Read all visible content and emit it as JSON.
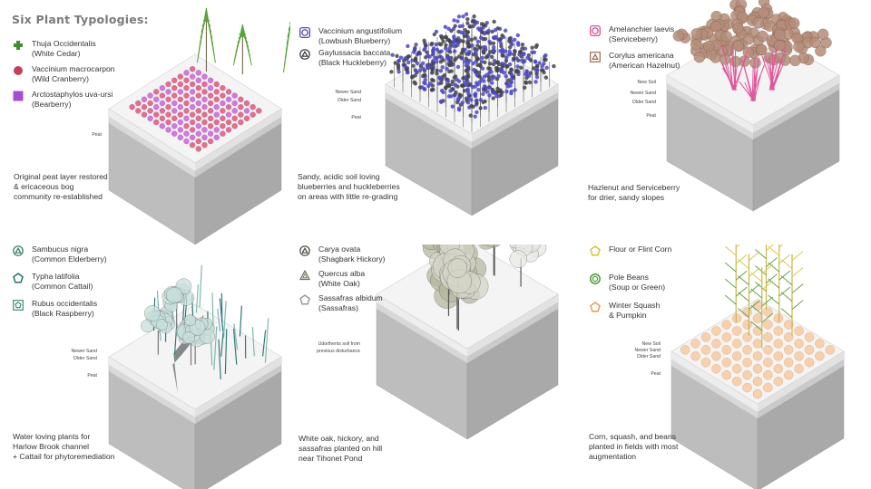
{
  "title": "Six Plant Typologies:",
  "panels": [
    {
      "legend": [
        {
          "name": "Thuja Occidentalis",
          "common": "(White Cedar)",
          "icon": "cross-icon",
          "color": "#3f8f2f"
        },
        {
          "name": "Vaccinium macrocarpon",
          "common": "(Wild Cranberry)",
          "icon": "circle-icon",
          "color": "#c6405e"
        },
        {
          "name": "Arctostaphylos uva-ursi",
          "common": "(Bearberry)",
          "icon": "square-icon",
          "color": "#a94ccf"
        }
      ],
      "layers": [
        "Peat"
      ],
      "caption": [
        "Original peat layer restored",
        "& ericaceous bog",
        "community re-established"
      ]
    },
    {
      "legend": [
        {
          "name": "Vaccinium angustifolium",
          "common": "(Lowbush Blueberry)",
          "icon": "circle-in-square-icon",
          "color": "#3c3ab0"
        },
        {
          "name": "Gaylussacia baccata",
          "common": "(Black Huckleberry)",
          "icon": "triangle-in-circle-icon",
          "color": "#333333"
        }
      ],
      "layers": [
        "Newer Sand",
        "Older Sand",
        "Peat"
      ],
      "caption": [
        "Sandy, acidic soil loving",
        "blueberries and huckleberries",
        "on areas with little re-grading"
      ]
    },
    {
      "legend": [
        {
          "name": "Amelanchier laevis",
          "common": "(Serviceberry)",
          "icon": "circle-in-square-icon",
          "color": "#d63c8e"
        },
        {
          "name": "Corylus americana",
          "common": "(American Hazelnut)",
          "icon": "triangle-in-square-icon",
          "color": "#9a6a52"
        }
      ],
      "layers": [
        "New Soil",
        "Newer Sand",
        "Older Sand",
        "Peat"
      ],
      "caption": [
        "Hazlenut and Serviceberry",
        "for drier, sandy slopes"
      ]
    },
    {
      "legend": [
        {
          "name": "Sambucus nigra",
          "common": "(Common Elderberry)",
          "icon": "triangle-in-circle-icon",
          "color": "#2e7a5c"
        },
        {
          "name": "Typha latifolia",
          "common": "(Common Cattail)",
          "icon": "pentagon-icon",
          "color": "#1f6f6a"
        },
        {
          "name": "Rubus occidentalis",
          "common": "(Black Raspberry)",
          "icon": "pentagon-in-square-icon",
          "color": "#3d8f7a"
        }
      ],
      "layers": [
        "Newer Sand",
        "Older Sand",
        "Peat"
      ],
      "caption": [
        "Water loving plants for",
        "Harlow Brook channel",
        "+ Cattail for phytoremediation"
      ]
    },
    {
      "legend": [
        {
          "name": "Carya ovata",
          "common": "(Shagbark Hickory)",
          "icon": "triangle-in-circle-icon",
          "color": "#4a4a40"
        },
        {
          "name": "Quercus alba",
          "common": "(White Oak)",
          "icon": "triangle-icon",
          "color": "#6a6a5a"
        },
        {
          "name": "Sassafras albidum",
          "common": "(Sassafras)",
          "icon": "pentagon-icon",
          "color": "#9a9a90"
        }
      ],
      "layers": [
        "Udorthents soil from",
        "previous disturbance"
      ],
      "caption": [
        "White oak, hickory, and",
        "sassafras planted on hill",
        "near Tihonet Pond"
      ]
    },
    {
      "legend": [
        {
          "name": "Flour or Flint Corn",
          "common": "",
          "icon": "pentagon-icon",
          "color": "#d7c23a"
        },
        {
          "name": "Pole Beans",
          "common": "(Soup or Green)",
          "icon": "circle-in-circle-icon",
          "color": "#4e9a3a"
        },
        {
          "name": "Winter Squash",
          "common": "& Pumpkin",
          "icon": "pentagon-icon",
          "color": "#ec9a4e"
        }
      ],
      "layers": [
        "New Soil",
        "Newer Sand",
        "Older Sand",
        "Peat"
      ],
      "caption": [
        "Corn, squash, and beans",
        "planted in fields with most",
        "augmentation"
      ]
    }
  ]
}
